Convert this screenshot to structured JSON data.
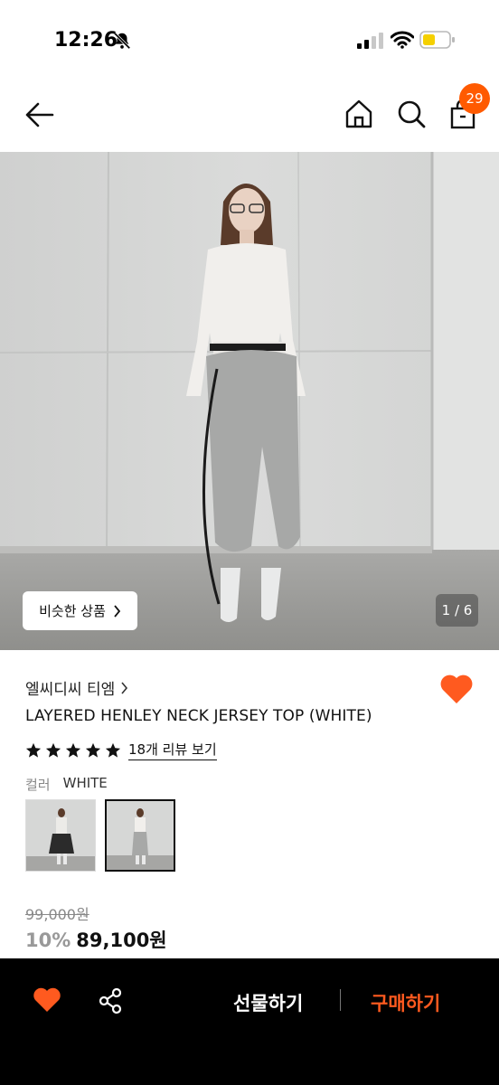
{
  "status_bar": {
    "time": "12:26",
    "icons": [
      "bell-slash-icon",
      "cellular-signal-icon",
      "wifi-icon",
      "battery-icon"
    ]
  },
  "nav": {
    "icons": [
      "back-arrow-icon",
      "home-icon",
      "search-icon",
      "shopping-bag-icon"
    ],
    "cart_count": "29"
  },
  "hero": {
    "similar_button_label": "비슷한 상품",
    "image_counter": "1 / 6"
  },
  "product": {
    "brand": "엘씨디씨 티엠",
    "title": "LAYERED HENLEY NECK JERSEY TOP (WHITE)",
    "rating_stars": 5,
    "review_link": "18개 리뷰 보기",
    "color_label": "컬러",
    "color_value": "WHITE",
    "original_price": "99,000원",
    "discount": "10%",
    "price": "89,100원"
  },
  "bottom_bar": {
    "gift_label": "선물하기",
    "buy_label": "구매하기",
    "icons": [
      "heart-icon",
      "share-icon"
    ]
  },
  "colors": {
    "accent": "#ff5a00",
    "heart": "#ff5a1f",
    "bottom_bar_bg": "#000000"
  }
}
